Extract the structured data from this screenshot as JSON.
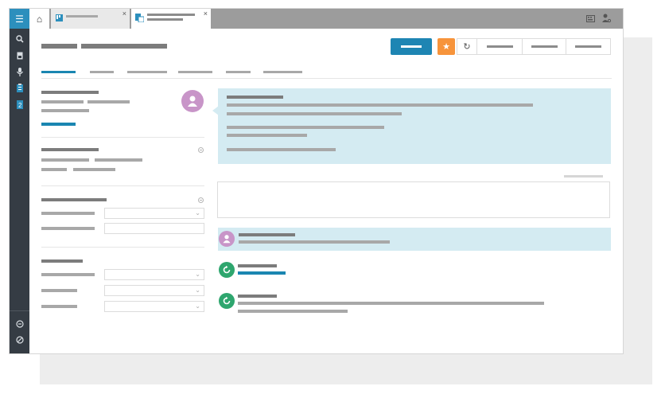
{
  "app": {
    "accent_color": "#2c8fbd",
    "sidebar_color": "#353c44",
    "panel_color": "#d4ebf2",
    "star_color": "#f7943b"
  },
  "sidebar": {
    "menu_icon": "☰",
    "search_icon": "⚲",
    "nav_icons": [
      "document-icon",
      "microphone-icon",
      "clipboard-icon",
      "numbered-doc-icon"
    ],
    "bottom_icons": [
      "arrow-circle-icon",
      "no-entry-icon"
    ]
  },
  "tabs": {
    "home_icon": "⌂",
    "close_glyph": "×"
  },
  "toolbar": {
    "star_glyph": "★",
    "refresh_glyph": "↻"
  },
  "form": {
    "chevron_glyph": "⌄"
  }
}
